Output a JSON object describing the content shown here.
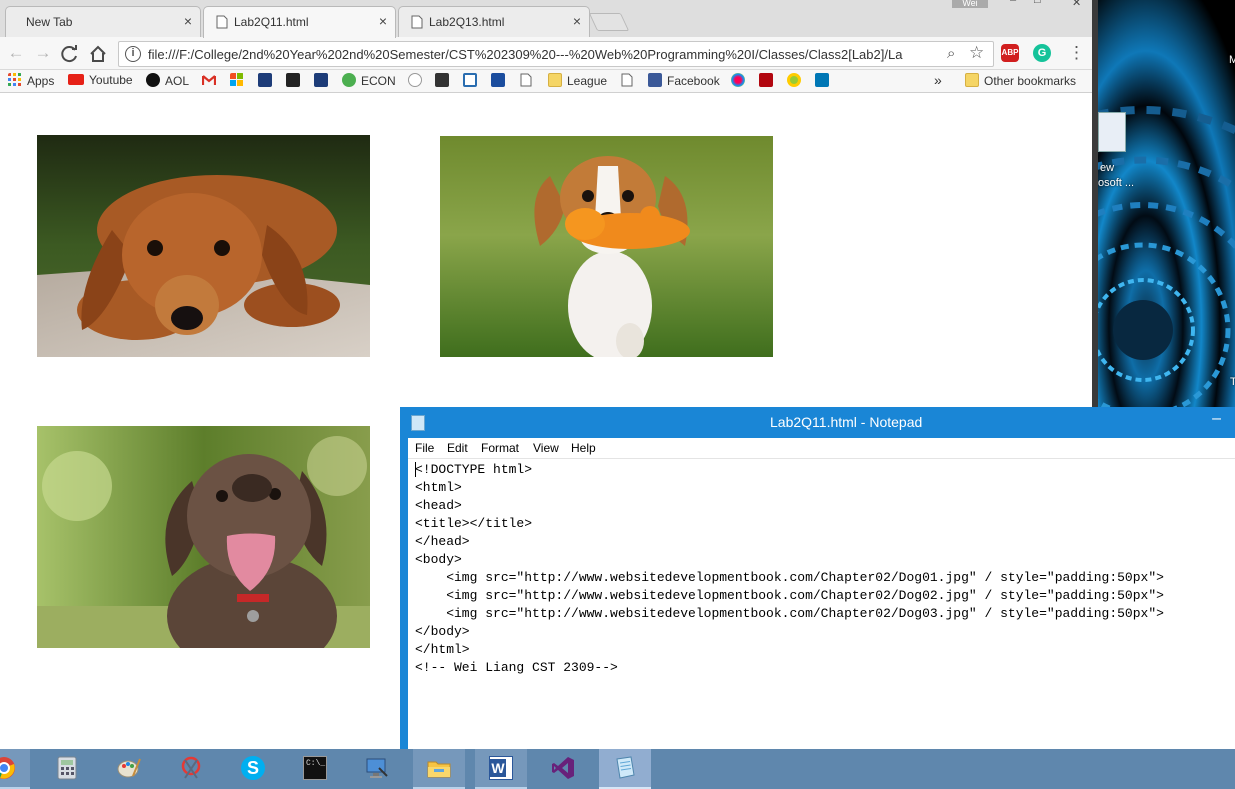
{
  "browser": {
    "tabs": [
      {
        "label": "New Tab",
        "close": "×"
      },
      {
        "label": "Lab2Q11.html",
        "close": "×"
      },
      {
        "label": "Lab2Q13.html",
        "close": "×"
      }
    ],
    "window_controls": {
      "user": "Wei",
      "minimize": "–",
      "maximize": "□",
      "close": "✕"
    },
    "nav": {
      "back": "←",
      "forward": "→",
      "reload": "C",
      "home": "⌂"
    },
    "omnibox": {
      "info": "i",
      "url": "file:///F:/College/2nd%20Year%202nd%20Semester/CST%202309%20---%20Web%20Programming%20I/Classes/Class2[Lab2]/La",
      "zoom": "⌕",
      "star": "☆"
    },
    "extensions": {
      "adblock": "ABP",
      "grammarly": "G",
      "menu": "⋮"
    },
    "bookmarks": [
      {
        "label": "Apps",
        "icon": "apps-grid-icon"
      },
      {
        "label": "Youtube",
        "icon": "youtube-icon"
      },
      {
        "label": "AOL",
        "icon": "aol-icon"
      },
      {
        "label": "",
        "icon": "gmail-icon"
      },
      {
        "label": "",
        "icon": "microsoft-icon"
      },
      {
        "label": "",
        "icon": "cuny-icon"
      },
      {
        "label": "",
        "icon": "blackboard-icon"
      },
      {
        "label": "",
        "icon": "cuny-icon-2"
      },
      {
        "label": "ECON",
        "icon": "econ-icon"
      },
      {
        "label": "",
        "icon": "amazon-icon"
      },
      {
        "label": "",
        "icon": "shopping-bag-icon"
      },
      {
        "label": "",
        "icon": "badge-icon"
      },
      {
        "label": "",
        "icon": "paypal-icon"
      },
      {
        "label": "",
        "icon": "page-icon"
      },
      {
        "label": "League",
        "icon": "folder-icon"
      },
      {
        "label": "",
        "icon": "page-icon-2"
      },
      {
        "label": "Facebook",
        "icon": "facebook-icon"
      },
      {
        "label": "",
        "icon": "flower-icon"
      },
      {
        "label": "",
        "icon": "netflix-icon"
      },
      {
        "label": "",
        "icon": "sun-icon"
      },
      {
        "label": "",
        "icon": "linkedin-icon"
      }
    ],
    "bookmarks_overflow": "»",
    "other_bookmarks": "Other bookmarks"
  },
  "page": {
    "images": [
      {
        "name": "dog01-dachshund",
        "src": "http://www.websitedevelopmentbook.com/Chapter02/Dog01.jpg"
      },
      {
        "name": "dog02-beagle",
        "src": "http://www.websitedevelopmentbook.com/Chapter02/Dog02.jpg"
      },
      {
        "name": "dog03-labrador",
        "src": "http://www.websitedevelopmentbook.com/Chapter02/Dog03.jpg"
      }
    ]
  },
  "desktop": {
    "icon_label_1": "ew",
    "icon_label_2": "osoft ...",
    "edge_letter_1": "M",
    "edge_letter_2": "T"
  },
  "notepad": {
    "title": "Lab2Q11.html - Notepad",
    "minimize": "–",
    "menu": [
      "File",
      "Edit",
      "Format",
      "View",
      "Help"
    ],
    "lines": [
      "<!DOCTYPE html>",
      "<html>",
      "<head>",
      "<title></title>",
      "</head>",
      "<body>",
      "    <img src=\"http://www.websitedevelopmentbook.com/Chapter02/Dog01.jpg\" / style=\"padding:50px\">",
      "    <img src=\"http://www.websitedevelopmentbook.com/Chapter02/Dog02.jpg\" / style=\"padding:50px\">",
      "    <img src=\"http://www.websitedevelopmentbook.com/Chapter02/Dog03.jpg\" / style=\"padding:50px\">",
      "</body>",
      "</html>",
      "<!-- Wei Liang CST 2309-->"
    ]
  },
  "taskbar": {
    "items": [
      {
        "name": "chrome-icon",
        "state": "open"
      },
      {
        "name": "calculator-icon",
        "state": "idle"
      },
      {
        "name": "paint-icon",
        "state": "idle"
      },
      {
        "name": "snipping-tool-icon",
        "state": "idle"
      },
      {
        "name": "skype-icon",
        "state": "idle"
      },
      {
        "name": "command-prompt-icon",
        "state": "idle"
      },
      {
        "name": "remote-desktop-icon",
        "state": "idle"
      },
      {
        "name": "file-explorer-icon",
        "state": "open"
      },
      {
        "name": "word-icon",
        "state": "open"
      },
      {
        "name": "visual-studio-icon",
        "state": "idle"
      },
      {
        "name": "notepad-icon",
        "state": "active"
      }
    ],
    "skype_letter": "S",
    "word_letter": "W",
    "cmd_text": "C:\\_"
  }
}
